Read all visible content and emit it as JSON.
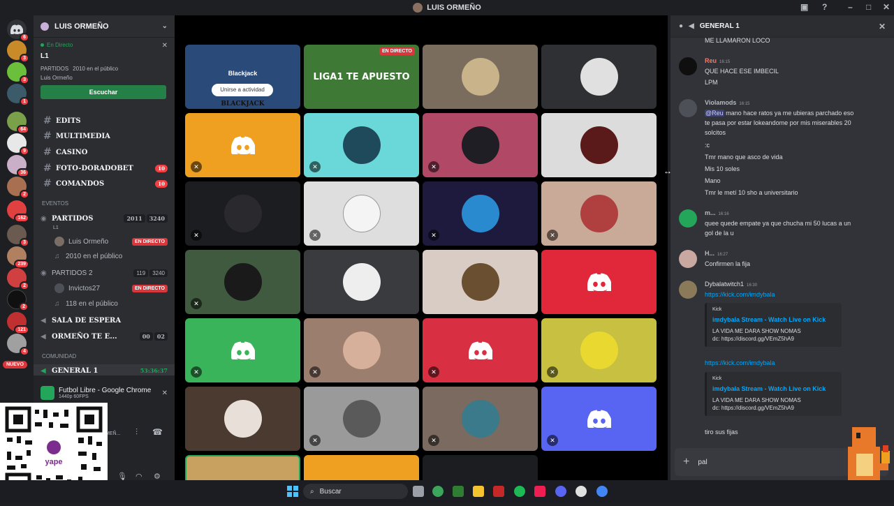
{
  "window": {
    "title": "LUIS ORMEÑO"
  },
  "sidebar": {
    "server_name": "LUIS ORMEÑO",
    "live": {
      "status": "En Directo",
      "channel": "L1",
      "meta_channel": "PARTIDOS",
      "meta_public": "2010 en el público",
      "host": "Luis Ormeño",
      "listen_button": "Escuchar"
    },
    "channels": [
      {
        "label": "EDITS",
        "badge": ""
      },
      {
        "label": "MULTIMEDIA",
        "badge": ""
      },
      {
        "label": "CASINO",
        "badge": ""
      },
      {
        "label": "FOTO-DORADOBET",
        "badge": "10"
      },
      {
        "label": "COMANDOS",
        "badge": "10"
      }
    ],
    "category_events": "EVENTOS",
    "voice": {
      "partidos": {
        "label": "PARTIDOS",
        "count1": "2011",
        "count2": "3240",
        "sub": "L1"
      },
      "partidos_user": "Luis Ormeño",
      "partidos_live": "EN DIRECTO",
      "partidos_public": "2010 en el público",
      "partidos2": {
        "label": "PARTIDOS 2",
        "count1": "119",
        "count2": "3240"
      },
      "p2_user": "Invictos27",
      "p2_live": "EN DIRECTO",
      "p2_public": "118 en el público",
      "sala": "SALA DE ESPERA",
      "ormeno": "ORMEÑO TE E...",
      "ormeno_cnt1": "00",
      "ormeno_cnt2": "02"
    },
    "category_comunidad": "COMUNIDAD",
    "general": {
      "label": "GENERAL 1",
      "timer": "53:36:37"
    },
    "new_badge": "NUEVO",
    "stream": {
      "title": "Futbol Libre - Google Chrome",
      "sub": "1440p 60FPS"
    },
    "user_tag": "RMEÑ..."
  },
  "stage": {
    "activity_title": "Blackjack",
    "activity_join": "Unirse a actividad",
    "activity_footer": "BLACKJACK",
    "live_label": "EN DIRECTO",
    "stream_text": "LIGA1 TE APUESTO"
  },
  "chat": {
    "title": "GENERAL 1",
    "messages": [
      {
        "text": "ME LLAMARON LOCO"
      },
      {
        "author": "Reu",
        "time": "16:15",
        "lines": [
          "QUE HACE ESE IMBECIL",
          "LPM"
        ]
      },
      {
        "author": "Violamods",
        "time": "16:15",
        "mention": "@Reu",
        "lines": [
          "mano hace ratos ya me ubieras parchado eso",
          "te pasa por estar lokeandome por mis miserables 20",
          "solcitos",
          ":c",
          "Tmr mano que asco de vida",
          "Mis 10 soles",
          "Mano",
          "Tmr le metí 10 sho a universitario"
        ]
      },
      {
        "author": "m...",
        "time": "16:16",
        "lines": [
          "quee quede empate ya que chucha mi 50 lucas a un",
          "gol de la u"
        ]
      },
      {
        "author": "H...",
        "time": "16:27",
        "lines": [
          "Confirmen la fija"
        ]
      },
      {
        "author": "Dybalatwitch1",
        "time": "16:30",
        "link": "https://kick.com/imdybala"
      }
    ],
    "embed": {
      "provider": "Kick",
      "title": "imdybala Stream - Watch Live on Kick",
      "desc1": "LA VIDA ME DARA SHOW NOMAS",
      "desc2": "dc: https://discord.gg/VEmZ5hA9"
    },
    "link2": "https://kick.com/imdybala",
    "last_message": "tiro sus fijas",
    "composer_value": "pal"
  },
  "taskbar": {
    "search_placeholder": "Buscar"
  },
  "colors": {
    "blurple": "#5865f2",
    "green": "#23a55a",
    "red": "#da373c",
    "link": "#00a8fc"
  }
}
